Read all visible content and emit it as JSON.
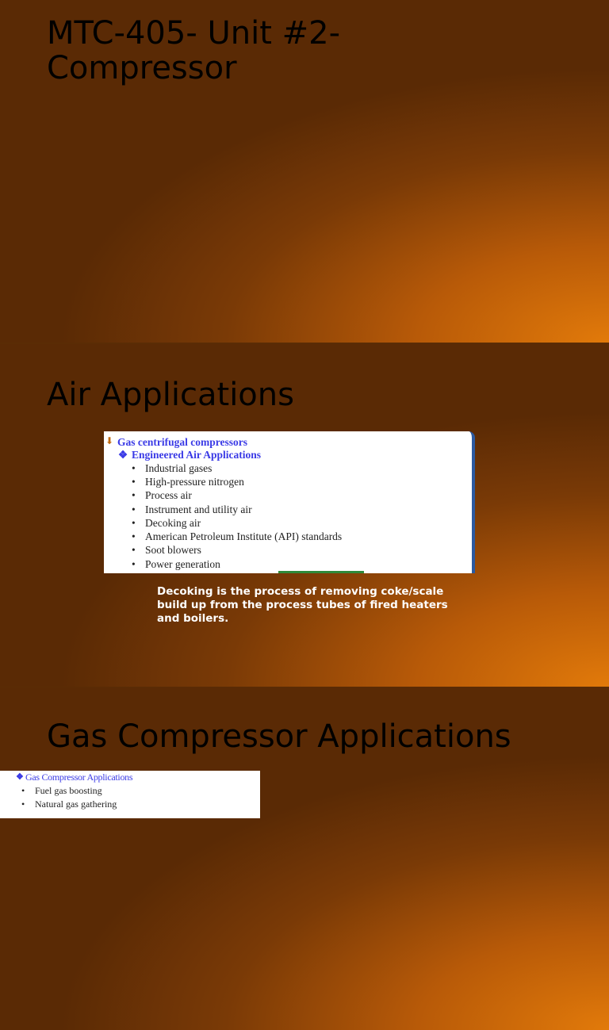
{
  "slides": [
    {
      "title": "MTC-405- Unit #2- Compressor"
    },
    {
      "title": "Air Applications",
      "image": {
        "heading": "Gas centrifugal compressors",
        "subheading": "Engineered Air Applications",
        "items": [
          "Industrial gases",
          "High-pressure nitrogen",
          "Process air",
          "Instrument and utility air",
          "Decoking air",
          "American Petroleum Institute (API) standards",
          "Soot blowers",
          "Power generation"
        ]
      },
      "caption": "Decoking is the process of removing coke/scale build up from the process tubes of fired heaters and boilers."
    },
    {
      "title": "Gas Compressor Applications",
      "image": {
        "subheading": "Gas Compressor Applications",
        "items": [
          "Fuel gas boosting",
          "Natural gas gathering"
        ]
      }
    }
  ]
}
